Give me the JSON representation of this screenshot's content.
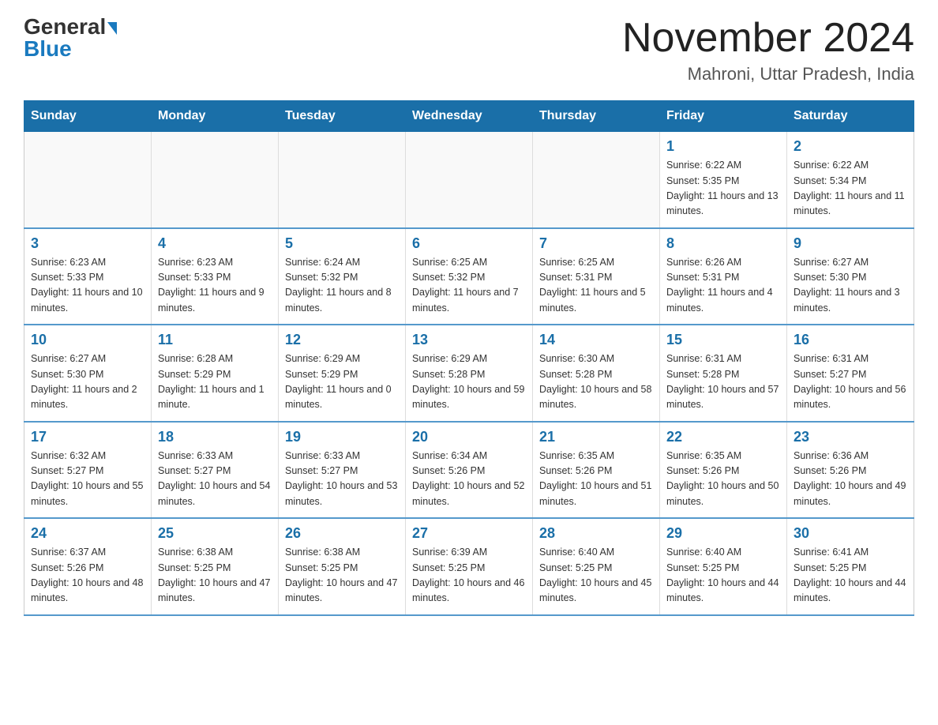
{
  "logo": {
    "general": "General",
    "blue": "Blue"
  },
  "header": {
    "title": "November 2024",
    "subtitle": "Mahroni, Uttar Pradesh, India"
  },
  "days_of_week": [
    "Sunday",
    "Monday",
    "Tuesday",
    "Wednesday",
    "Thursday",
    "Friday",
    "Saturday"
  ],
  "weeks": [
    [
      {
        "day": "",
        "info": ""
      },
      {
        "day": "",
        "info": ""
      },
      {
        "day": "",
        "info": ""
      },
      {
        "day": "",
        "info": ""
      },
      {
        "day": "",
        "info": ""
      },
      {
        "day": "1",
        "info": "Sunrise: 6:22 AM\nSunset: 5:35 PM\nDaylight: 11 hours and 13 minutes."
      },
      {
        "day": "2",
        "info": "Sunrise: 6:22 AM\nSunset: 5:34 PM\nDaylight: 11 hours and 11 minutes."
      }
    ],
    [
      {
        "day": "3",
        "info": "Sunrise: 6:23 AM\nSunset: 5:33 PM\nDaylight: 11 hours and 10 minutes."
      },
      {
        "day": "4",
        "info": "Sunrise: 6:23 AM\nSunset: 5:33 PM\nDaylight: 11 hours and 9 minutes."
      },
      {
        "day": "5",
        "info": "Sunrise: 6:24 AM\nSunset: 5:32 PM\nDaylight: 11 hours and 8 minutes."
      },
      {
        "day": "6",
        "info": "Sunrise: 6:25 AM\nSunset: 5:32 PM\nDaylight: 11 hours and 7 minutes."
      },
      {
        "day": "7",
        "info": "Sunrise: 6:25 AM\nSunset: 5:31 PM\nDaylight: 11 hours and 5 minutes."
      },
      {
        "day": "8",
        "info": "Sunrise: 6:26 AM\nSunset: 5:31 PM\nDaylight: 11 hours and 4 minutes."
      },
      {
        "day": "9",
        "info": "Sunrise: 6:27 AM\nSunset: 5:30 PM\nDaylight: 11 hours and 3 minutes."
      }
    ],
    [
      {
        "day": "10",
        "info": "Sunrise: 6:27 AM\nSunset: 5:30 PM\nDaylight: 11 hours and 2 minutes."
      },
      {
        "day": "11",
        "info": "Sunrise: 6:28 AM\nSunset: 5:29 PM\nDaylight: 11 hours and 1 minute."
      },
      {
        "day": "12",
        "info": "Sunrise: 6:29 AM\nSunset: 5:29 PM\nDaylight: 11 hours and 0 minutes."
      },
      {
        "day": "13",
        "info": "Sunrise: 6:29 AM\nSunset: 5:28 PM\nDaylight: 10 hours and 59 minutes."
      },
      {
        "day": "14",
        "info": "Sunrise: 6:30 AM\nSunset: 5:28 PM\nDaylight: 10 hours and 58 minutes."
      },
      {
        "day": "15",
        "info": "Sunrise: 6:31 AM\nSunset: 5:28 PM\nDaylight: 10 hours and 57 minutes."
      },
      {
        "day": "16",
        "info": "Sunrise: 6:31 AM\nSunset: 5:27 PM\nDaylight: 10 hours and 56 minutes."
      }
    ],
    [
      {
        "day": "17",
        "info": "Sunrise: 6:32 AM\nSunset: 5:27 PM\nDaylight: 10 hours and 55 minutes."
      },
      {
        "day": "18",
        "info": "Sunrise: 6:33 AM\nSunset: 5:27 PM\nDaylight: 10 hours and 54 minutes."
      },
      {
        "day": "19",
        "info": "Sunrise: 6:33 AM\nSunset: 5:27 PM\nDaylight: 10 hours and 53 minutes."
      },
      {
        "day": "20",
        "info": "Sunrise: 6:34 AM\nSunset: 5:26 PM\nDaylight: 10 hours and 52 minutes."
      },
      {
        "day": "21",
        "info": "Sunrise: 6:35 AM\nSunset: 5:26 PM\nDaylight: 10 hours and 51 minutes."
      },
      {
        "day": "22",
        "info": "Sunrise: 6:35 AM\nSunset: 5:26 PM\nDaylight: 10 hours and 50 minutes."
      },
      {
        "day": "23",
        "info": "Sunrise: 6:36 AM\nSunset: 5:26 PM\nDaylight: 10 hours and 49 minutes."
      }
    ],
    [
      {
        "day": "24",
        "info": "Sunrise: 6:37 AM\nSunset: 5:26 PM\nDaylight: 10 hours and 48 minutes."
      },
      {
        "day": "25",
        "info": "Sunrise: 6:38 AM\nSunset: 5:25 PM\nDaylight: 10 hours and 47 minutes."
      },
      {
        "day": "26",
        "info": "Sunrise: 6:38 AM\nSunset: 5:25 PM\nDaylight: 10 hours and 47 minutes."
      },
      {
        "day": "27",
        "info": "Sunrise: 6:39 AM\nSunset: 5:25 PM\nDaylight: 10 hours and 46 minutes."
      },
      {
        "day": "28",
        "info": "Sunrise: 6:40 AM\nSunset: 5:25 PM\nDaylight: 10 hours and 45 minutes."
      },
      {
        "day": "29",
        "info": "Sunrise: 6:40 AM\nSunset: 5:25 PM\nDaylight: 10 hours and 44 minutes."
      },
      {
        "day": "30",
        "info": "Sunrise: 6:41 AM\nSunset: 5:25 PM\nDaylight: 10 hours and 44 minutes."
      }
    ]
  ]
}
